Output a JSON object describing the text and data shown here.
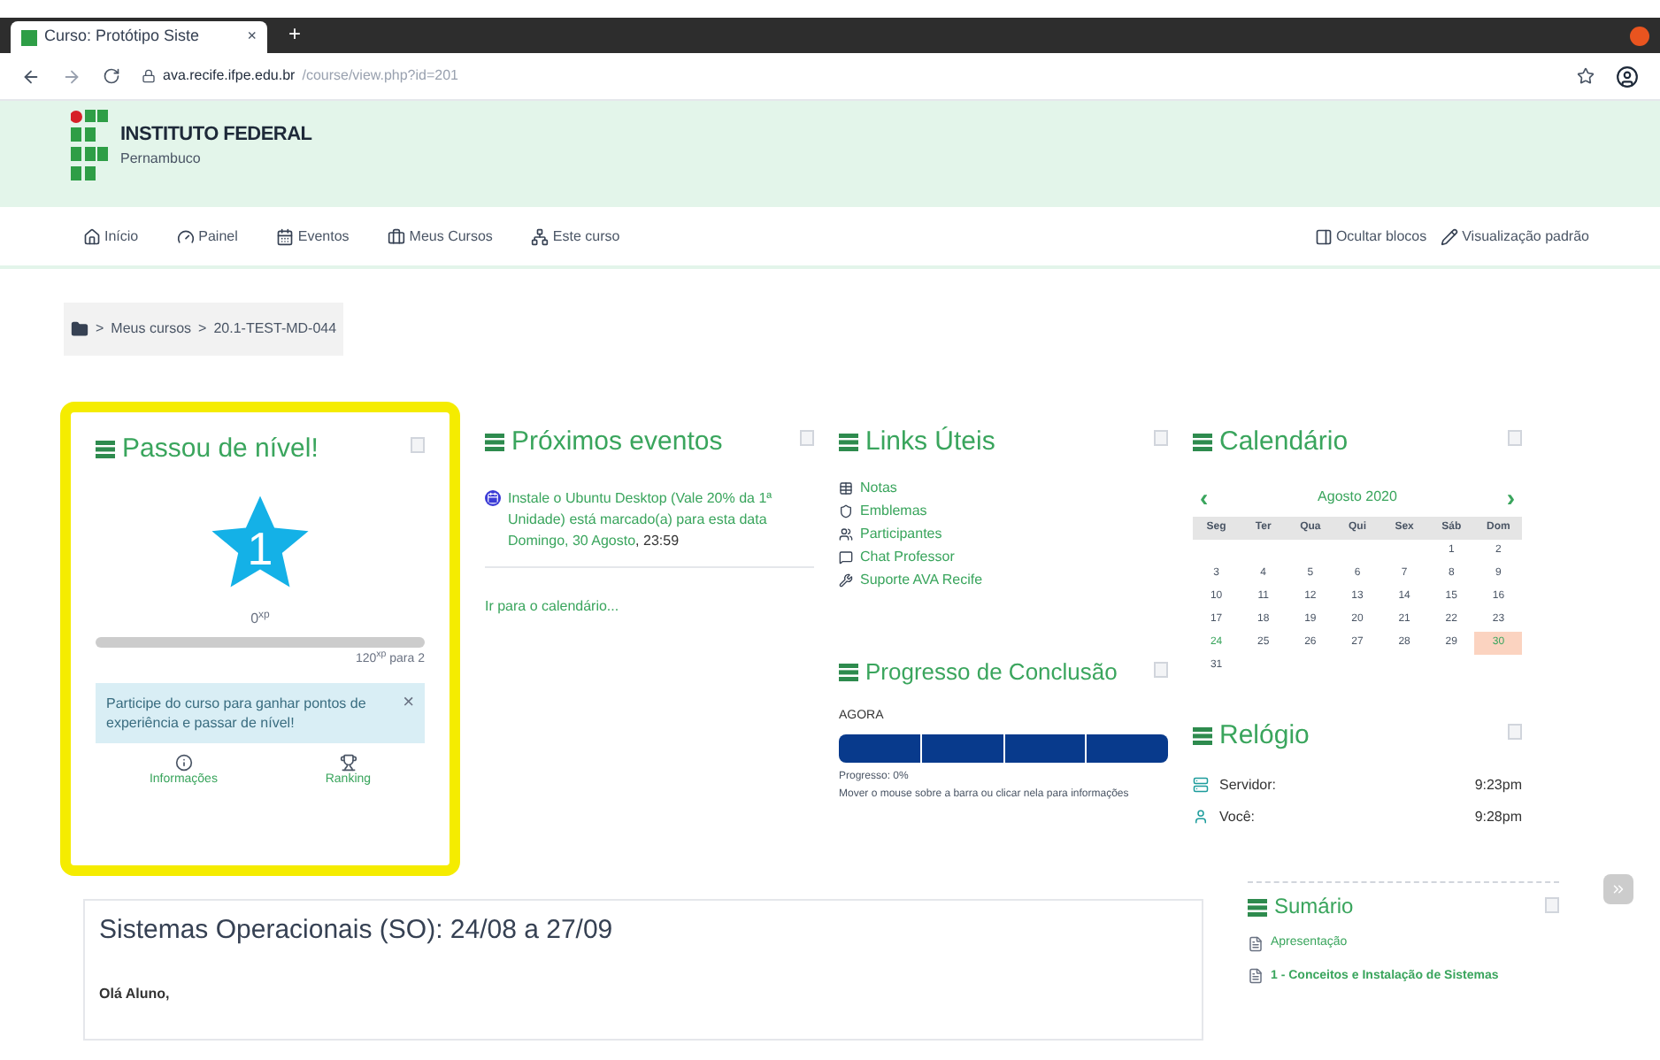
{
  "browser": {
    "tab_title": "Curso: Protótipo Siste",
    "tab_close": "×",
    "new_tab": "+",
    "url_host": "ava.recife.ifpe.edu.br",
    "url_path": "/course/view.php?id=201"
  },
  "header": {
    "logo_title": "INSTITUTO FEDERAL",
    "logo_subtitle": "Pernambuco"
  },
  "nav": {
    "items": [
      {
        "label": "Início"
      },
      {
        "label": "Painel"
      },
      {
        "label": "Eventos"
      },
      {
        "label": "Meus Cursos"
      },
      {
        "label": "Este curso"
      }
    ],
    "right": [
      {
        "label": "Ocultar blocos"
      },
      {
        "label": "Visualização padrão"
      }
    ]
  },
  "breadcrumb": {
    "separator": ">",
    "items": [
      "Meus cursos",
      "20.1-TEST-MD-044"
    ]
  },
  "xp_block": {
    "highlighted": true,
    "title": "Passou de nível!",
    "level_number": "1",
    "points": "0$^{xp}$",
    "level": 0,
    "to_next": "120$^{xp}$ para 2",
    "notice": "Participe do curso para ganhar pontos de experiência e passar de nível!",
    "notice_close": "×",
    "links": [
      {
        "label": "Informações"
      },
      {
        "label": "Ranking"
      }
    ]
  },
  "events_block": {
    "title": "Próximos eventos",
    "events": [
      {
        "name": "Instale o Ubuntu Desktop (Vale 20% da 1ª Unidade) está marcado(a) para esta data",
        "date": "Domingo, 30 Agosto",
        "time": ", 23:59"
      }
    ],
    "calendar_link": "Ir para o calendário..."
  },
  "links_block": {
    "title": "Links Úteis",
    "links": [
      {
        "label": "Notas"
      },
      {
        "label": "Emblemas"
      },
      {
        "label": "Participantes"
      },
      {
        "label": "Chat Professor"
      },
      {
        "label": "Suporte AVA Recife"
      }
    ]
  },
  "progress_block": {
    "title": "Progresso de Conclusão",
    "label": "AGORA",
    "segments": [
      {
        "completed": false
      },
      {
        "completed": false
      },
      {
        "completed": false
      },
      {
        "completed": false
      }
    ],
    "progress_text": "Progresso: 0%",
    "hint": "Mover o mouse sobre a barra ou clicar nela para informações"
  },
  "calendar_block": {
    "title": "Calendário",
    "prev": "‹",
    "next": "›",
    "month": "Agosto 2020",
    "weekdays": [
      "Seg",
      "Ter",
      "Qua",
      "Qui",
      "Sex",
      "Sáb",
      "Dom"
    ],
    "days": [
      {
        "day": "1",
        "kind": "plain"
      },
      {
        "day": "2",
        "kind": "plain"
      },
      {
        "day": "3",
        "kind": "plain"
      },
      {
        "day": "4",
        "kind": "plain"
      },
      {
        "day": "5",
        "kind": "plain"
      },
      {
        "day": "6",
        "kind": "plain"
      },
      {
        "day": "7",
        "kind": "plain"
      },
      {
        "day": "8",
        "kind": "plain"
      },
      {
        "day": "9",
        "kind": "plain"
      },
      {
        "day": "10",
        "kind": "plain"
      },
      {
        "day": "11",
        "kind": "plain"
      },
      {
        "day": "12",
        "kind": "plain"
      },
      {
        "day": "13",
        "kind": "plain"
      },
      {
        "day": "14",
        "kind": "plain"
      },
      {
        "day": "15",
        "kind": "plain"
      },
      {
        "day": "16",
        "kind": "plain"
      },
      {
        "day": "17",
        "kind": "plain"
      },
      {
        "day": "18",
        "kind": "plain"
      },
      {
        "day": "19",
        "kind": "plain"
      },
      {
        "day": "20",
        "kind": "plain"
      },
      {
        "day": "21",
        "kind": "plain"
      },
      {
        "day": "22",
        "kind": "plain"
      },
      {
        "day": "23",
        "kind": "plain"
      },
      {
        "day": "24",
        "kind": "today"
      },
      {
        "day": "25",
        "kind": "plain"
      },
      {
        "day": "26",
        "kind": "plain"
      },
      {
        "day": "27",
        "kind": "plain"
      },
      {
        "day": "28",
        "kind": "plain"
      },
      {
        "day": "29",
        "kind": "plain"
      },
      {
        "day": "30",
        "kind": "event"
      },
      {
        "day": "31",
        "kind": "plain"
      }
    ]
  },
  "clock_block": {
    "title": "Relógio",
    "rows": [
      {
        "label": "Servidor:",
        "time": "9:23pm"
      },
      {
        "label": "Você:",
        "time": "9:28pm"
      }
    ]
  },
  "section": {
    "title": "Sistemas Operacionais (SO): 24/08 a 27/09",
    "greeting": "Olá Aluno,"
  },
  "summary_block": {
    "title": "Sumário",
    "items": [
      {
        "label": "Apresentação",
        "bold": false
      },
      {
        "label": "1 - Conceitos e Instalação de Sistemas",
        "bold": true
      }
    ]
  }
}
